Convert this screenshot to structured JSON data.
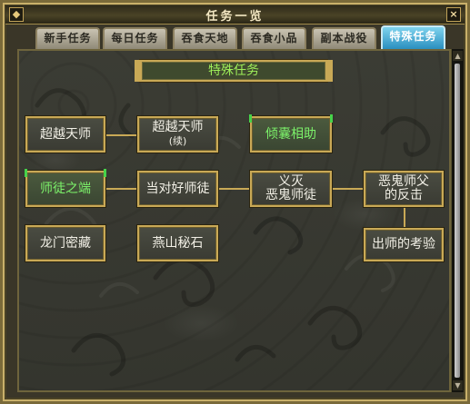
{
  "window": {
    "title": "任务一览",
    "close_label": "×"
  },
  "tabs": [
    {
      "label": "新手任务",
      "active": false
    },
    {
      "label": "每日任务",
      "active": false
    },
    {
      "label": "吞食天地",
      "active": false
    },
    {
      "label": "吞食小品",
      "active": false
    },
    {
      "label": "副本战役",
      "active": false
    },
    {
      "label": "特殊任务",
      "active": true
    }
  ],
  "category": {
    "title": "特殊任务"
  },
  "quests": {
    "chaoyue_tianshi": {
      "label": "超越天师"
    },
    "chaoyue_tianshi_xu": {
      "label": "超越天师",
      "sub": "(续)"
    },
    "qingnang_xiangzhu": {
      "label": "倾囊相助",
      "state": "highlighted"
    },
    "shitu_zhiduan": {
      "label": "师徒之端",
      "state": "highlighted"
    },
    "dangdui_hao_shitu": {
      "label": "当对好师徒"
    },
    "yimie_egui_shitu": {
      "label": "义灭",
      "sub": "恶鬼师徒"
    },
    "egui_shifu_fanji": {
      "label": "恶鬼师父",
      "sub": "的反击"
    },
    "longmen_micang": {
      "label": "龙门密藏"
    },
    "yanshan_mishi": {
      "label": "燕山秘石"
    },
    "chushi_kaoyan": {
      "label": "出师的考验"
    }
  },
  "colors": {
    "gold_border": "#c9a956",
    "highlight_text": "#7cf26a",
    "active_tab": "#2a8fbf"
  }
}
